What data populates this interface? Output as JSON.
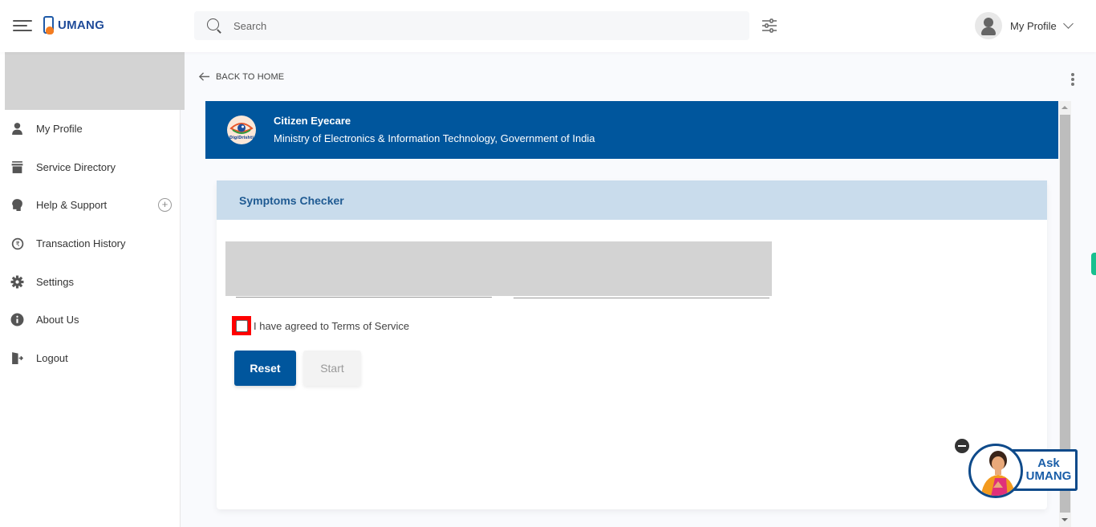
{
  "header": {
    "app_name": "UMANG",
    "search_placeholder": "Search",
    "profile_label": "My Profile"
  },
  "sidebar": {
    "items": [
      {
        "label": "My Profile",
        "icon": "user-icon"
      },
      {
        "label": "Service Directory",
        "icon": "archive-icon"
      },
      {
        "label": "Help & Support",
        "icon": "support-icon",
        "expandable": true
      },
      {
        "label": "Transaction History",
        "icon": "rupee-history-icon"
      },
      {
        "label": "Settings",
        "icon": "gear-icon"
      },
      {
        "label": "About Us",
        "icon": "info-icon"
      },
      {
        "label": "Logout",
        "icon": "logout-icon"
      }
    ]
  },
  "main": {
    "back_label": "BACK TO HOME",
    "department": {
      "title": "Citizen Eyecare",
      "subtitle": "Ministry of Electronics & Information Technology, Government of India",
      "logo_text": "DigiDrishti"
    },
    "card": {
      "title": "Symptoms Checker",
      "terms_label": "I have agreed to Terms of Service",
      "terms_checked": false,
      "reset_label": "Reset",
      "start_label": "Start"
    }
  },
  "assistant": {
    "line1": "Ask",
    "line2": "UMANG"
  },
  "colors": {
    "primary": "#00569d",
    "card_header": "#c9dcec",
    "highlight": "#ff0000"
  }
}
